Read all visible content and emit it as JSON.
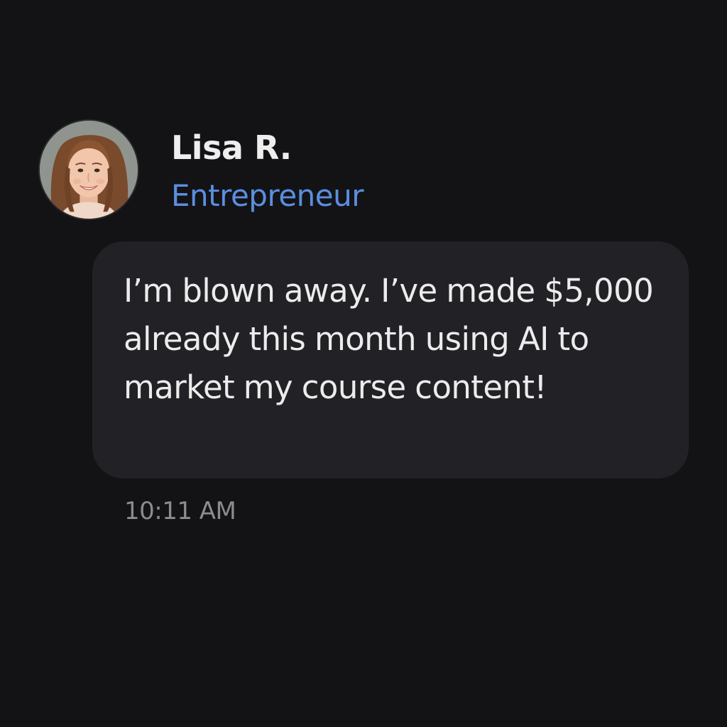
{
  "message": {
    "sender": {
      "name": "Lisa R.",
      "title": "Entrepreneur",
      "avatar_icon": "user-photo-avatar"
    },
    "text": "I’m blown away. I’ve made $5,000 already this month using AI to market my course content!",
    "timestamp": "10:11 AM"
  },
  "colors": {
    "background": "#131316",
    "bubble": "#222226",
    "name_text": "#eeeeee",
    "title_text": "#5b8ee0",
    "message_text": "#ececec",
    "timestamp_text": "#8b8b90"
  }
}
